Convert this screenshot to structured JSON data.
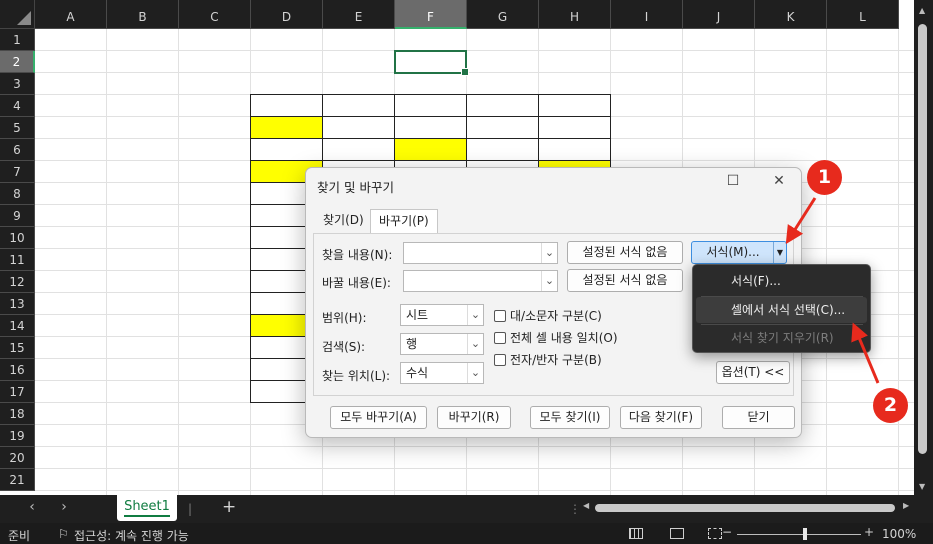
{
  "sheet": {
    "columns": [
      "A",
      "B",
      "C",
      "D",
      "E",
      "F",
      "G",
      "H",
      "I",
      "J",
      "K",
      "L"
    ],
    "selected_column": "F",
    "rows": [
      "1",
      "2",
      "3",
      "4",
      "5",
      "6",
      "7",
      "8",
      "9",
      "10",
      "11",
      "12",
      "13",
      "14",
      "15",
      "16",
      "17",
      "18",
      "19",
      "20",
      "21"
    ],
    "selected_row": "2",
    "table": {
      "columns": [
        "D",
        "E",
        "F",
        "G",
        "H"
      ],
      "first_row": "4",
      "last_row": "17",
      "yellow_cells": [
        "D5",
        "F6",
        "D7",
        "H7",
        "D14"
      ]
    },
    "active_cell": "F2",
    "colors": {
      "fill": "#ffff00",
      "selection": "#217346",
      "header_bg": "#1f1f1f"
    }
  },
  "tabbar": {
    "prev_icon": "chevron-left-icon",
    "next_icon": "chevron-right-icon",
    "sheet_tab": "Sheet1",
    "add_label": "+"
  },
  "statusbar": {
    "ready": "준비",
    "accessibility": "접근성: 계속 진행 가능",
    "zoom_minus": "−",
    "zoom_plus": "+",
    "zoom": "100%",
    "zoom_level": 1.0
  },
  "dialog": {
    "title": "찾기 및 바꾸기",
    "tabs": [
      "찾기(D)",
      "바꾸기(P)"
    ],
    "active_tab": "바꾸기(P)",
    "find_label": "찾을 내용(N):",
    "find_value": "",
    "replace_label": "바꿀 내용(E):",
    "replace_value": "",
    "find_format_preview": "설정된 서식 없음",
    "replace_format_preview": "설정된 서식 없음",
    "format_button": "서식(M)...",
    "within_label": "범위(H):",
    "within_value": "시트",
    "search_label": "검색(S):",
    "search_value": "행",
    "lookin_label": "찾는 위치(L):",
    "lookin_value": "수식",
    "match_case": "대/소문자 구분(C)",
    "match_entire": "전체 셀 내용 일치(O)",
    "match_byte": "전자/반자 구분(B)",
    "options_button": "옵션(T) <<",
    "buttons": {
      "replace_all": "모두 바꾸기(A)",
      "replace": "바꾸기(R)",
      "find_all": "모두 찾기(I)",
      "find_next": "다음 찾기(F)",
      "close": "닫기"
    }
  },
  "menu": {
    "items": [
      {
        "label": "서식(F)...",
        "enabled": true
      },
      {
        "label": "셀에서 서식 선택(C)...",
        "enabled": true
      },
      {
        "label": "서식 찾기 지우기(R)",
        "enabled": false
      }
    ]
  },
  "annotations": {
    "badge1": "1",
    "badge2": "2",
    "color": "#e72a1d"
  }
}
